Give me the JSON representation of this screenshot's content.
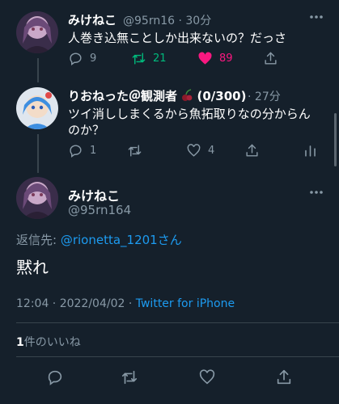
{
  "tweets": [
    {
      "name": "みけねこ",
      "handle": "@95rn16",
      "sep": "·",
      "time": "30分",
      "text": "人巻き込無ことしか出来ないの？だっさ",
      "reply_count": "9",
      "retweet_count": "21",
      "like_count": "89"
    },
    {
      "name": "りおねった＠観測者",
      "name_suffix": "(0/300)",
      "sep": "·",
      "time": "27分",
      "text": "ツイ消ししまくるから魚拓取りなの分からんのか？",
      "reply_count": "1",
      "retweet_count": "",
      "like_count": "4"
    }
  ],
  "main_tweet": {
    "name": "みけねこ",
    "handle": "@95rn164",
    "reply_to_prefix": "返信先: ",
    "reply_to_handle": "@rionetta_1201",
    "reply_to_suffix": "さん",
    "text": "黙れ",
    "timestamp": "12:04 · 2022/04/02 · ",
    "client": "Twitter for iPhone",
    "likes_count": "1",
    "likes_label": "件のいいね"
  },
  "colors": {
    "background": "#15202b",
    "text_secondary": "#8899a6",
    "retweet_active": "#00ba7c",
    "like_active": "#f91880",
    "link": "#1d9bf0"
  },
  "icons": [
    "reply-icon",
    "retweet-icon",
    "like-icon",
    "share-icon",
    "analytics-icon",
    "more-icon"
  ]
}
